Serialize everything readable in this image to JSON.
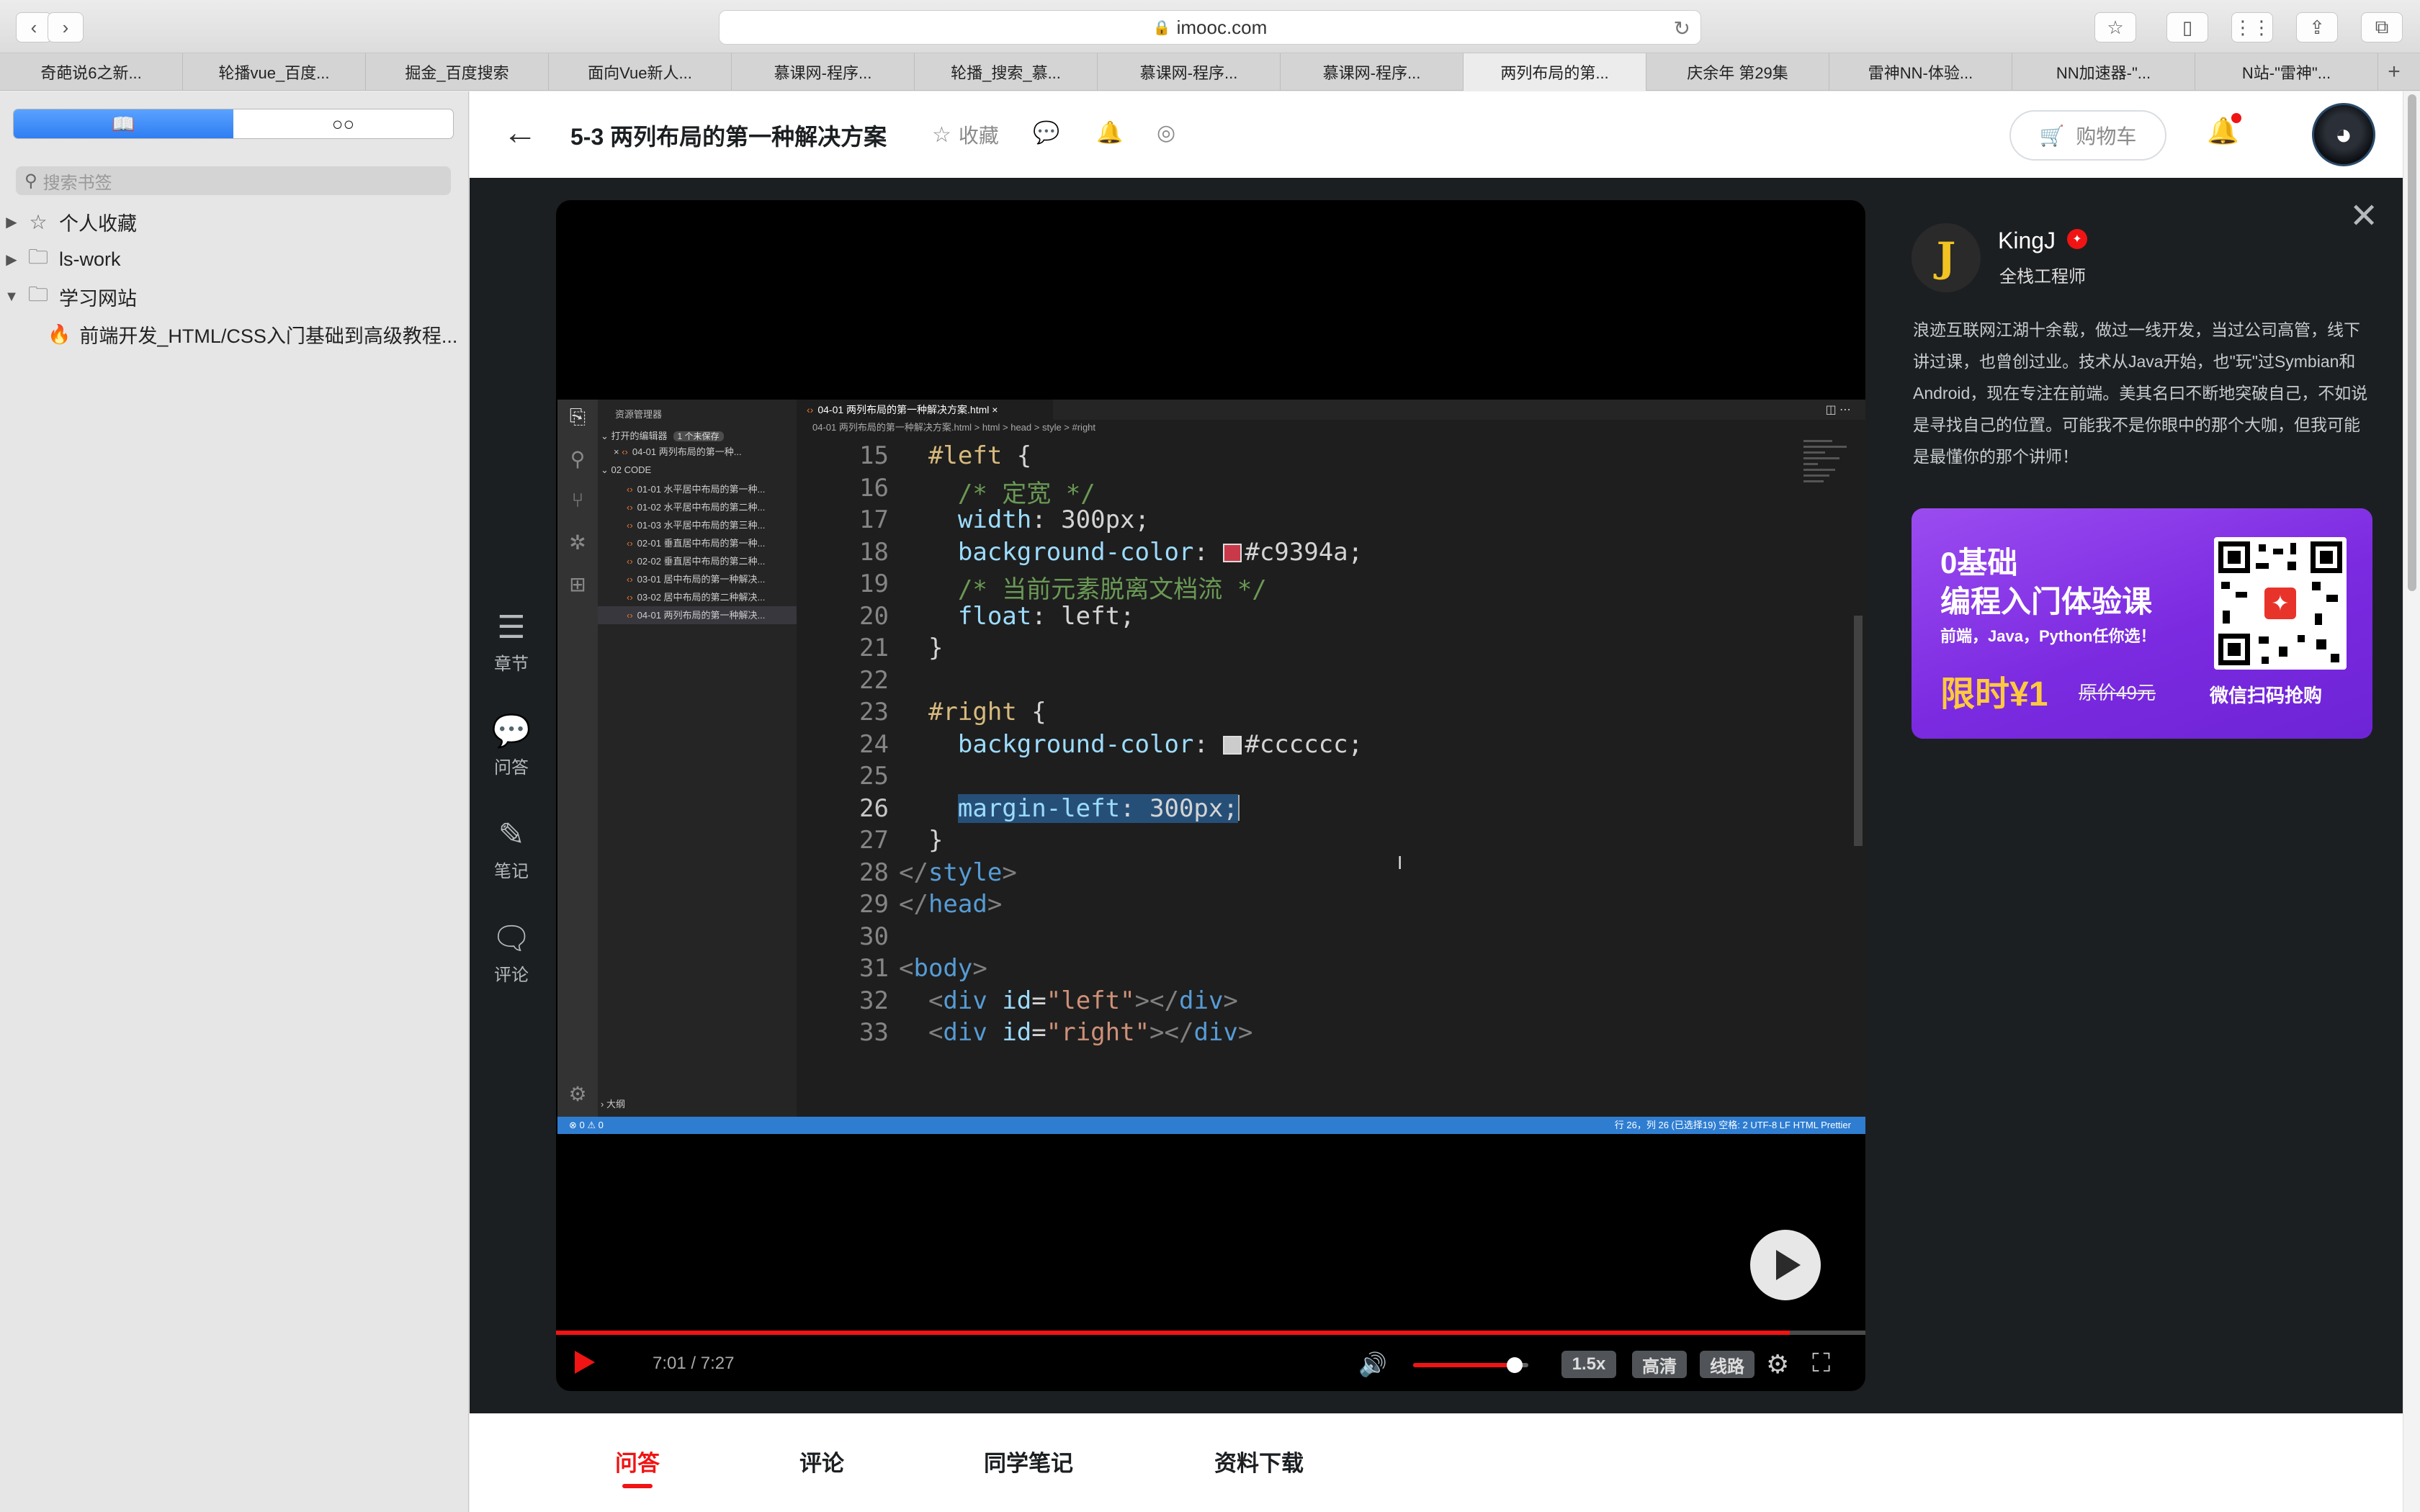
{
  "browser": {
    "address": "imooc.com",
    "tabs": [
      "奇葩说6之新...",
      "轮播vue_百度...",
      "掘金_百度搜索",
      "面向Vue新人...",
      "慕课网-程序...",
      "轮播_搜索_慕...",
      "慕课网-程序...",
      "慕课网-程序...",
      "两列布局的第...",
      "庆余年 第29集",
      "雷神NN-体验...",
      "NN加速器-\"...",
      "N站-\"雷神\"..."
    ],
    "active_tab_index": 8
  },
  "sidebar": {
    "search_placeholder": "搜索书签",
    "items": [
      {
        "label": "个人收藏",
        "icon": "star-icon"
      },
      {
        "label": "ls-work",
        "icon": "folder-icon"
      },
      {
        "label": "学习网站",
        "icon": "folder-icon"
      }
    ],
    "child_item": "前端开发_HTML/CSS入门基础到高级教程..."
  },
  "header": {
    "title": "5-3 两列布局的第一种解决方案",
    "favorite_label": "收藏",
    "cart_label": "购物车"
  },
  "left_tools": [
    {
      "label": "章节",
      "icon": "chapters-icon"
    },
    {
      "label": "问答",
      "icon": "qa-icon"
    },
    {
      "label": "笔记",
      "icon": "note-icon"
    },
    {
      "label": "评论",
      "icon": "comment-icon"
    }
  ],
  "vscode": {
    "explorer_title": "资源管理器",
    "open_editors": "打开的编辑器",
    "unsaved_badge": "1 个未保存",
    "open_file": "04-01 两列布局的第一种...",
    "folder": "02 CODE",
    "files": [
      "01-01 水平居中布局的第一种...",
      "01-02 水平居中布局的第二种...",
      "01-03 水平居中布局的第三种...",
      "02-01 垂直居中布局的第一种...",
      "02-02 垂直居中布局的第二种...",
      "03-01 居中布局的第一种解决...",
      "03-02 居中布局的第二种解决...",
      "04-01 两列布局的第一种解决..."
    ],
    "outline": "大纲",
    "tab_name": "04-01 两列布局的第一种解决方案.html",
    "breadcrumb": "04-01 两列布局的第一种解决方案.html > html > head > style > #right",
    "status_left": "⊗ 0 ⚠ 0",
    "status_right": "行 26，列 26 (已选择19)   空格: 2   UTF-8   LF   HTML   Prettier",
    "current_line": 26,
    "lines": [
      {
        "n": "15",
        "parts": [
          {
            "c": "t-sel",
            "t": "  #left "
          },
          {
            "c": "t-val",
            "t": "{"
          }
        ]
      },
      {
        "n": "16",
        "parts": [
          {
            "c": "t-cmt",
            "t": "    /* 定宽 */"
          }
        ]
      },
      {
        "n": "17",
        "parts": [
          {
            "c": "t-prop",
            "t": "    width"
          },
          {
            "c": "t-val",
            "t": ": 300px;"
          }
        ]
      },
      {
        "n": "18",
        "parts": [
          {
            "c": "t-prop",
            "t": "    background-color"
          },
          {
            "c": "t-val",
            "t": ": "
          },
          {
            "c": "swatch",
            "color": "#c9394a"
          },
          {
            "c": "t-val",
            "t": "#c9394a;"
          }
        ]
      },
      {
        "n": "19",
        "parts": [
          {
            "c": "t-cmt",
            "t": "    /* 当前元素脱离文档流 */"
          }
        ]
      },
      {
        "n": "20",
        "parts": [
          {
            "c": "t-prop",
            "t": "    float"
          },
          {
            "c": "t-val",
            "t": ": left;"
          }
        ]
      },
      {
        "n": "21",
        "parts": [
          {
            "c": "t-val",
            "t": "  }"
          }
        ]
      },
      {
        "n": "22",
        "parts": []
      },
      {
        "n": "23",
        "parts": [
          {
            "c": "t-sel",
            "t": "  #right "
          },
          {
            "c": "t-val",
            "t": "{"
          }
        ]
      },
      {
        "n": "24",
        "parts": [
          {
            "c": "t-prop",
            "t": "    background-color"
          },
          {
            "c": "t-val",
            "t": ": "
          },
          {
            "c": "swatch",
            "color": "#cccccc"
          },
          {
            "c": "t-val",
            "t": "#cccccc;"
          }
        ]
      },
      {
        "n": "25",
        "parts": []
      },
      {
        "n": "26",
        "parts": [
          {
            "c": "t-val",
            "t": "    "
          },
          {
            "c": "t-prop hl",
            "t": "margin-left"
          },
          {
            "c": "t-val hl",
            "t": ": 300px;"
          },
          {
            "c": "caret",
            "t": ""
          }
        ]
      },
      {
        "n": "27",
        "parts": [
          {
            "c": "t-val",
            "t": "  }"
          }
        ]
      },
      {
        "n": "28",
        "parts": [
          {
            "c": "t-punc",
            "t": "</"
          },
          {
            "c": "t-tag",
            "t": "style"
          },
          {
            "c": "t-punc",
            "t": ">"
          }
        ]
      },
      {
        "n": "29",
        "parts": [
          {
            "c": "t-punc",
            "t": "</"
          },
          {
            "c": "t-tag",
            "t": "head"
          },
          {
            "c": "t-punc",
            "t": ">"
          }
        ]
      },
      {
        "n": "30",
        "parts": []
      },
      {
        "n": "31",
        "parts": [
          {
            "c": "t-punc",
            "t": "<"
          },
          {
            "c": "t-tag",
            "t": "body"
          },
          {
            "c": "t-punc",
            "t": ">"
          }
        ]
      },
      {
        "n": "32",
        "parts": [
          {
            "c": "t-punc",
            "t": "  <"
          },
          {
            "c": "t-tag",
            "t": "div "
          },
          {
            "c": "t-prop",
            "t": "id"
          },
          {
            "c": "t-val",
            "t": "="
          },
          {
            "c": "t-str",
            "t": "\"left\""
          },
          {
            "c": "t-punc",
            "t": "></"
          },
          {
            "c": "t-tag",
            "t": "div"
          },
          {
            "c": "t-punc",
            "t": ">"
          }
        ]
      },
      {
        "n": "33",
        "parts": [
          {
            "c": "t-punc",
            "t": "  <"
          },
          {
            "c": "t-tag",
            "t": "div "
          },
          {
            "c": "t-prop",
            "t": "id"
          },
          {
            "c": "t-val",
            "t": "="
          },
          {
            "c": "t-str",
            "t": "\"right\""
          },
          {
            "c": "t-punc",
            "t": "></"
          },
          {
            "c": "t-tag",
            "t": "div"
          },
          {
            "c": "t-punc",
            "t": ">"
          }
        ]
      }
    ]
  },
  "player": {
    "time": "7:01 / 7:27",
    "progress": 0.942,
    "volume": 0.88,
    "speed": "1.5x",
    "quality": "高清",
    "route": "线路"
  },
  "teacher": {
    "name": "KingJ",
    "role": "全栈工程师",
    "bio": "浪迹互联网江湖十余载，做过一线开发，当过公司高管，线下讲过课，也曾创过业。技术从Java开始，也\"玩\"过Symbian和Android，现在专注在前端。美其名曰不断地突破自己，不如说是寻找自己的位置。可能我不是你眼中的那个大咖，但我可能是最懂你的那个讲师！"
  },
  "promo": {
    "line1": "0基础",
    "line2": "编程入门体验课",
    "line3": "前端，Java，Python任你选！",
    "price": "限时¥1",
    "original": "原价49元",
    "cta": "微信扫码抢购"
  },
  "bottom_tabs": [
    "问答",
    "评论",
    "同学笔记",
    "资料下载"
  ],
  "colors": {
    "accent": "#f01414",
    "selection": "#264f78",
    "statusbar": "#2e7dd1",
    "promo": "#7b2ae0"
  }
}
